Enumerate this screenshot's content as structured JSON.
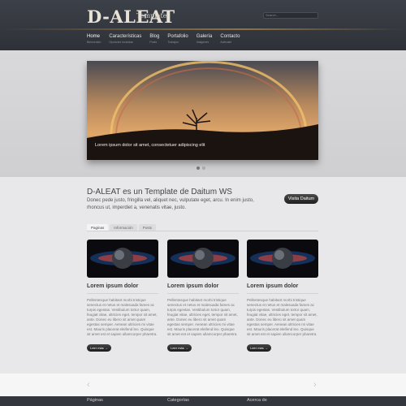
{
  "header": {
    "logo": "D-ALEAT",
    "logo_sub": "Template",
    "search_placeholder": "Search..."
  },
  "nav": [
    {
      "label": "Home",
      "sub": "Bienvenido"
    },
    {
      "label": "Características",
      "sub": "Opciones Incluidas"
    },
    {
      "label": "Blog",
      "sub": "Posts"
    },
    {
      "label": "Portafolio",
      "sub": "Trabajos"
    },
    {
      "label": "Galería",
      "sub": "Imágenes"
    },
    {
      "label": "Contacto",
      "sub": "Acércate"
    }
  ],
  "slider": {
    "caption": "Lorem ipsum dolor sit amet, consectetuer adipiscing elit"
  },
  "intro": {
    "title": "D-ALEAT es un Template de Daitum WS",
    "text": "Donec pede justo, fringilla vel, aliquet nec, vulputate eget, arcu. In enim justo, rhoncus ut, imperdiet a, venenatis vitae, justo.",
    "button": "Visita Daitum"
  },
  "tabs": [
    "Paginas",
    "Información",
    "Posts"
  ],
  "cards": [
    {
      "title": "Lorem ipsum dolor",
      "text": "Pellentesque habitant morbi tristique senectus et netus et malesuada fames ac turpis egestas. Vestibulum tortor quam, feugiat vitae, ultricies eget, tempor sit amet, ante. Donec eu libero sit amet quam egestas semper. Aenean ultricies mi vitae est. Mauris placerat eleifend leo. Quisque sit amet est et sapien ullamcorper pharetra.",
      "button": "Leer más →"
    },
    {
      "title": "Lorem ipsum dolor",
      "text": "Pellentesque habitant morbi tristique senectus et netus et malesuada fames ac turpis egestas. Vestibulum tortor quam, feugiat vitae, ultricies eget, tempor sit amet, ante. Donec eu libero sit amet quam egestas semper. Aenean ultricies mi vitae est. Mauris placerat eleifend leo. Quisque sit amet est et sapien ullamcorper pharetra.",
      "button": "Leer más →"
    },
    {
      "title": "Lorem ipsum dolor",
      "text": "Pellentesque habitant morbi tristique senectus et netus et malesuada fames ac turpis egestas. Vestibulum tortor quam, feugiat vitae, ultricies eget, tempor sit amet, ante. Donec eu libero sit amet quam egestas semper. Aenean ultricies mi vitae est. Mauris placerat eleifend leo. Quisque sit amet est et sapien ullamcorper pharetra.",
      "button": "Leer más →"
    }
  ],
  "footer": {
    "col1": "Páginas",
    "col2": "Categorías",
    "col3": "Acerca de"
  },
  "arrows": {
    "prev": "‹",
    "next": "›"
  },
  "colors": {
    "header_bg": "#33363c",
    "page_bg": "#e8e8ea",
    "button_dark": "#1f1f1f"
  }
}
